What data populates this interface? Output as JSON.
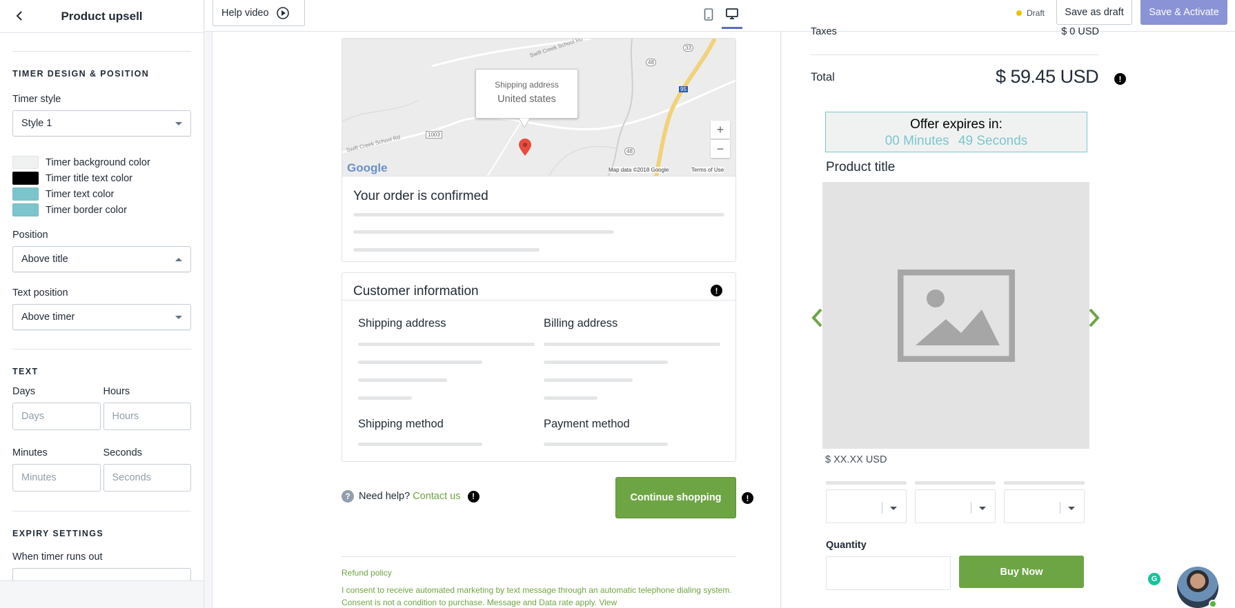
{
  "sidebar": {
    "title": "Product upsell",
    "timer_section": "TIMER DESIGN & POSITION",
    "timer_style_label": "Timer style",
    "timer_style_value": "Style 1",
    "colors": [
      {
        "label": "Timer background color",
        "color": "#f0f2f2"
      },
      {
        "label": "Timer title text color",
        "color": "#000000"
      },
      {
        "label": "Timer text color",
        "color": "#7dc5cd"
      },
      {
        "label": "Timer border color",
        "color": "#7dc5cd"
      }
    ],
    "position_label": "Position",
    "position_value": "Above title",
    "text_position_label": "Text position",
    "text_position_value": "Above timer",
    "text_section": "TEXT",
    "days_label": "Days",
    "days_placeholder": "Days",
    "hours_label": "Hours",
    "hours_placeholder": "Hours",
    "minutes_label": "Minutes",
    "minutes_placeholder": "Minutes",
    "seconds_label": "Seconds",
    "seconds_placeholder": "Seconds",
    "expiry_section": "EXPIRY SETTINGS",
    "when_runs_out_label": "When timer runs out"
  },
  "topbar": {
    "help_video": "Help video",
    "status": "Draft",
    "save_draft": "Save as draft",
    "save_activate": "Save & Activate",
    "accent": "#5c6ac4"
  },
  "map": {
    "callout_line1": "Shipping address",
    "callout_line2": "United states",
    "zoom_in": "+",
    "zoom_out": "−",
    "brand": "Google",
    "attribution": "Map data ©2018 Google",
    "terms": "Terms of Use",
    "road_label": "Swift Creek School Rd",
    "road_label_2": "Swift Creek School Rd",
    "route_48": "48",
    "route_33": "33",
    "route_95": "95",
    "route_1003": "1003"
  },
  "order": {
    "confirmed": "Your order is confirmed"
  },
  "customer": {
    "title": "Customer information",
    "shipping_address": "Shipping address",
    "billing_address": "Billing address",
    "shipping_method": "Shipping method",
    "payment_method": "Payment method"
  },
  "help": {
    "need_help": "Need help?",
    "contact": "Contact us",
    "continue": "Continue shopping",
    "refund": "Refund policy",
    "consent": "I consent to receive automated marketing by text message through an automatic telephone dialing system. Consent is not a condition to purchase. Message and Data rate apply. View"
  },
  "summary": {
    "taxes_label": "Taxes",
    "taxes_value": "$ 0 USD",
    "total_label": "Total",
    "total_value": "$ 59.45 USD"
  },
  "offer": {
    "title": "Offer expires in:",
    "minutes": "00 Minutes",
    "seconds": "49 Seconds"
  },
  "product": {
    "title": "Product title",
    "price": "$ XX.XX USD",
    "quantity_label": "Quantity",
    "buy_now": "Buy Now",
    "accent": "#6da544"
  },
  "misc": {
    "grammarly": "G"
  }
}
